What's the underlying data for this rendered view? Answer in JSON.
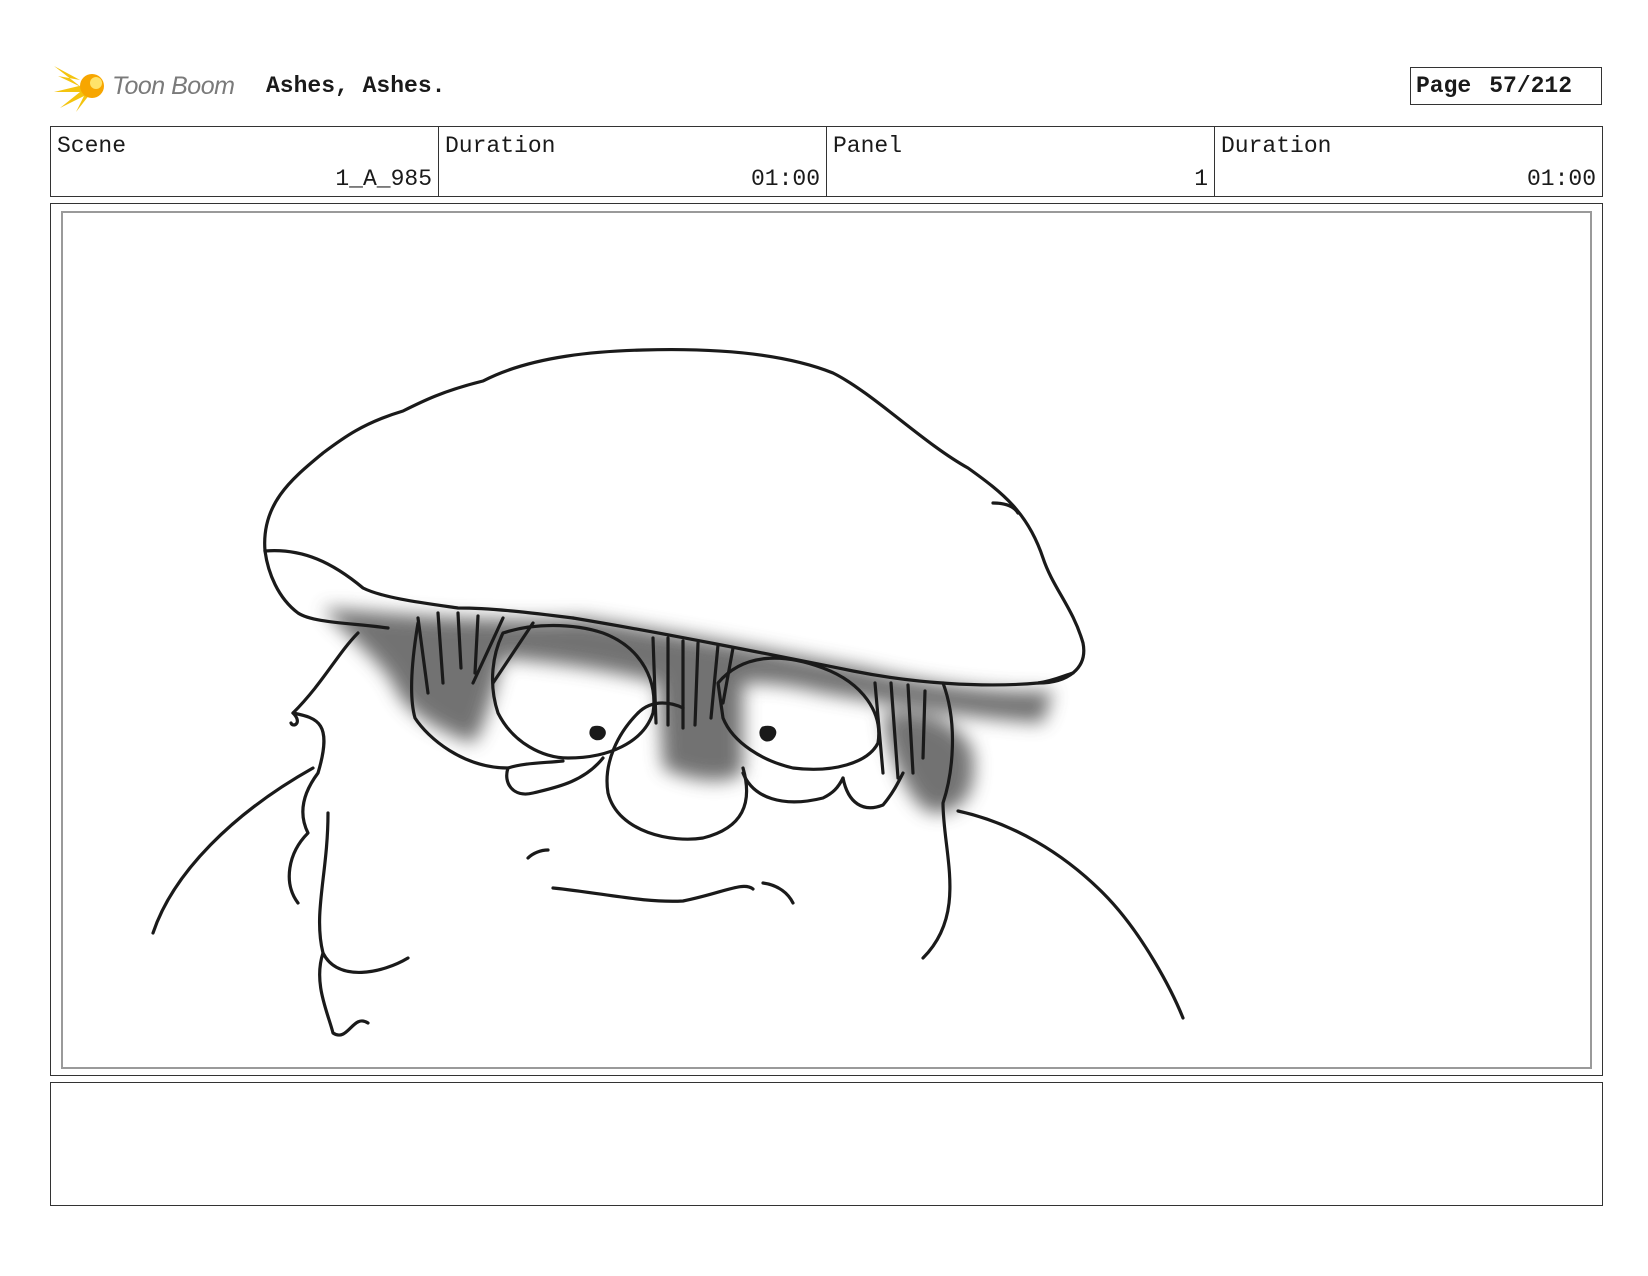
{
  "header": {
    "logo_text": "Toon Boom",
    "project_title": "Ashes, Ashes.",
    "page_label": "Page",
    "page_value": "57/212"
  },
  "info": [
    {
      "label": "Scene",
      "value": "1_A_985"
    },
    {
      "label": "Duration",
      "value": "01:00"
    },
    {
      "label": "Panel",
      "value": "1"
    },
    {
      "label": "Duration",
      "value": "01:00"
    }
  ],
  "panel": {
    "image": "storyboard sketch",
    "notes": ""
  }
}
